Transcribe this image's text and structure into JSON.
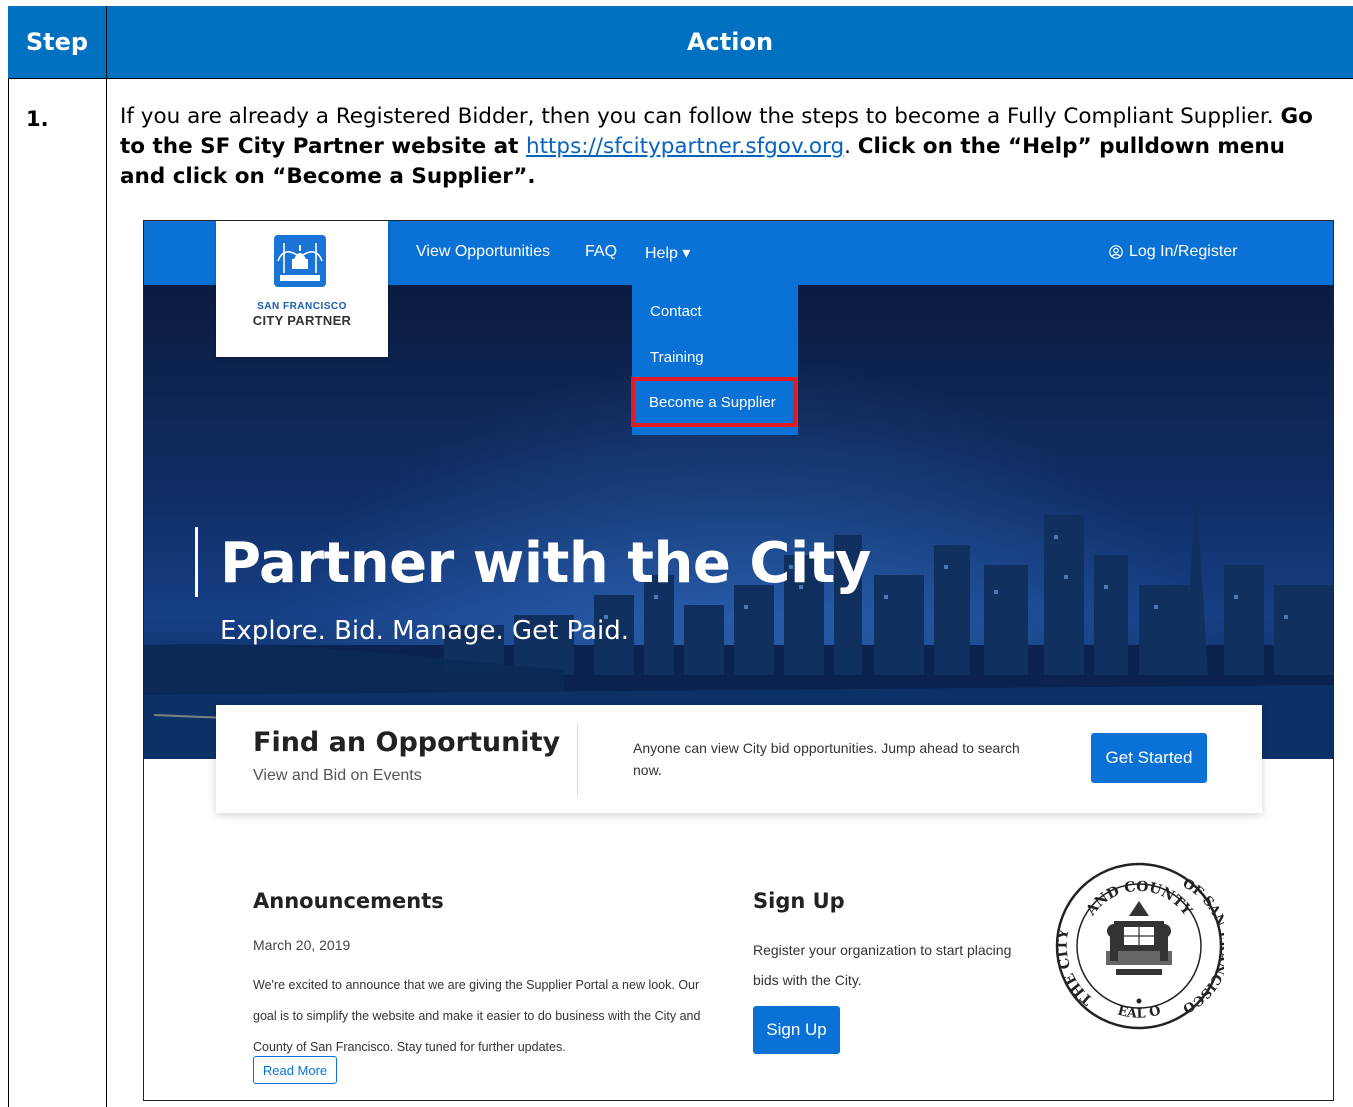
{
  "table": {
    "header_step": "Step",
    "header_action": "Action",
    "row": {
      "step_number": "1.",
      "text_plain_1": "If you are already a Registered Bidder, then you can follow the steps to become a Fully Compliant Supplier. ",
      "text_bold_1": "Go to the SF City Partner website at ",
      "link": "https://sfcitypartner.sfgov.org",
      "text_plain_2": ". ",
      "text_bold_2": "Click on the “Help” pulldown menu and click on “Become a Supplier”."
    }
  },
  "screenshot": {
    "logo": {
      "line1": "SAN FRANCISCO",
      "line2": "CITY PARTNER"
    },
    "nav": {
      "view_opportunities": "View Opportunities",
      "faq": "FAQ",
      "help": "Help ▾",
      "login": "Log In/Register"
    },
    "dropdown": {
      "contact": "Contact",
      "training": "Training",
      "become_supplier": "Become a Supplier"
    },
    "hero": {
      "title": "Partner with the City",
      "subtitle": "Explore. Bid. Manage. Get Paid."
    },
    "card": {
      "title": "Find an Opportunity",
      "subtitle": "View and Bid on Events",
      "text": "Anyone can view City bid opportunities. Jump ahead to search now.",
      "button": "Get Started"
    },
    "announcements": {
      "title": "Announcements",
      "date": "March 20, 2019",
      "body": "We're excited to announce that we are giving the Supplier Portal a new look. Our goal is to simplify the website and make it easier to do business with the City and County of San Francisco. Stay tuned for further updates.",
      "button": "Read More"
    },
    "signup": {
      "title": "Sign Up",
      "body": "Register your organization to start placing bids with the City.",
      "button": "Sign Up"
    },
    "seal": {
      "top_text": "AND COUNTY",
      "left_text": "THE CITY",
      "right_text": "OF SAN FRANCISCO",
      "bottom_text": "SEAL OF"
    },
    "colors": {
      "brand_blue": "#0a72d6",
      "highlight_red": "#e01b24",
      "table_header": "#0070c0"
    },
    "icons": {
      "login": "user-circle-icon",
      "logo": "city-hall-bridge-icon",
      "help_caret": "chevron-down-icon"
    }
  }
}
